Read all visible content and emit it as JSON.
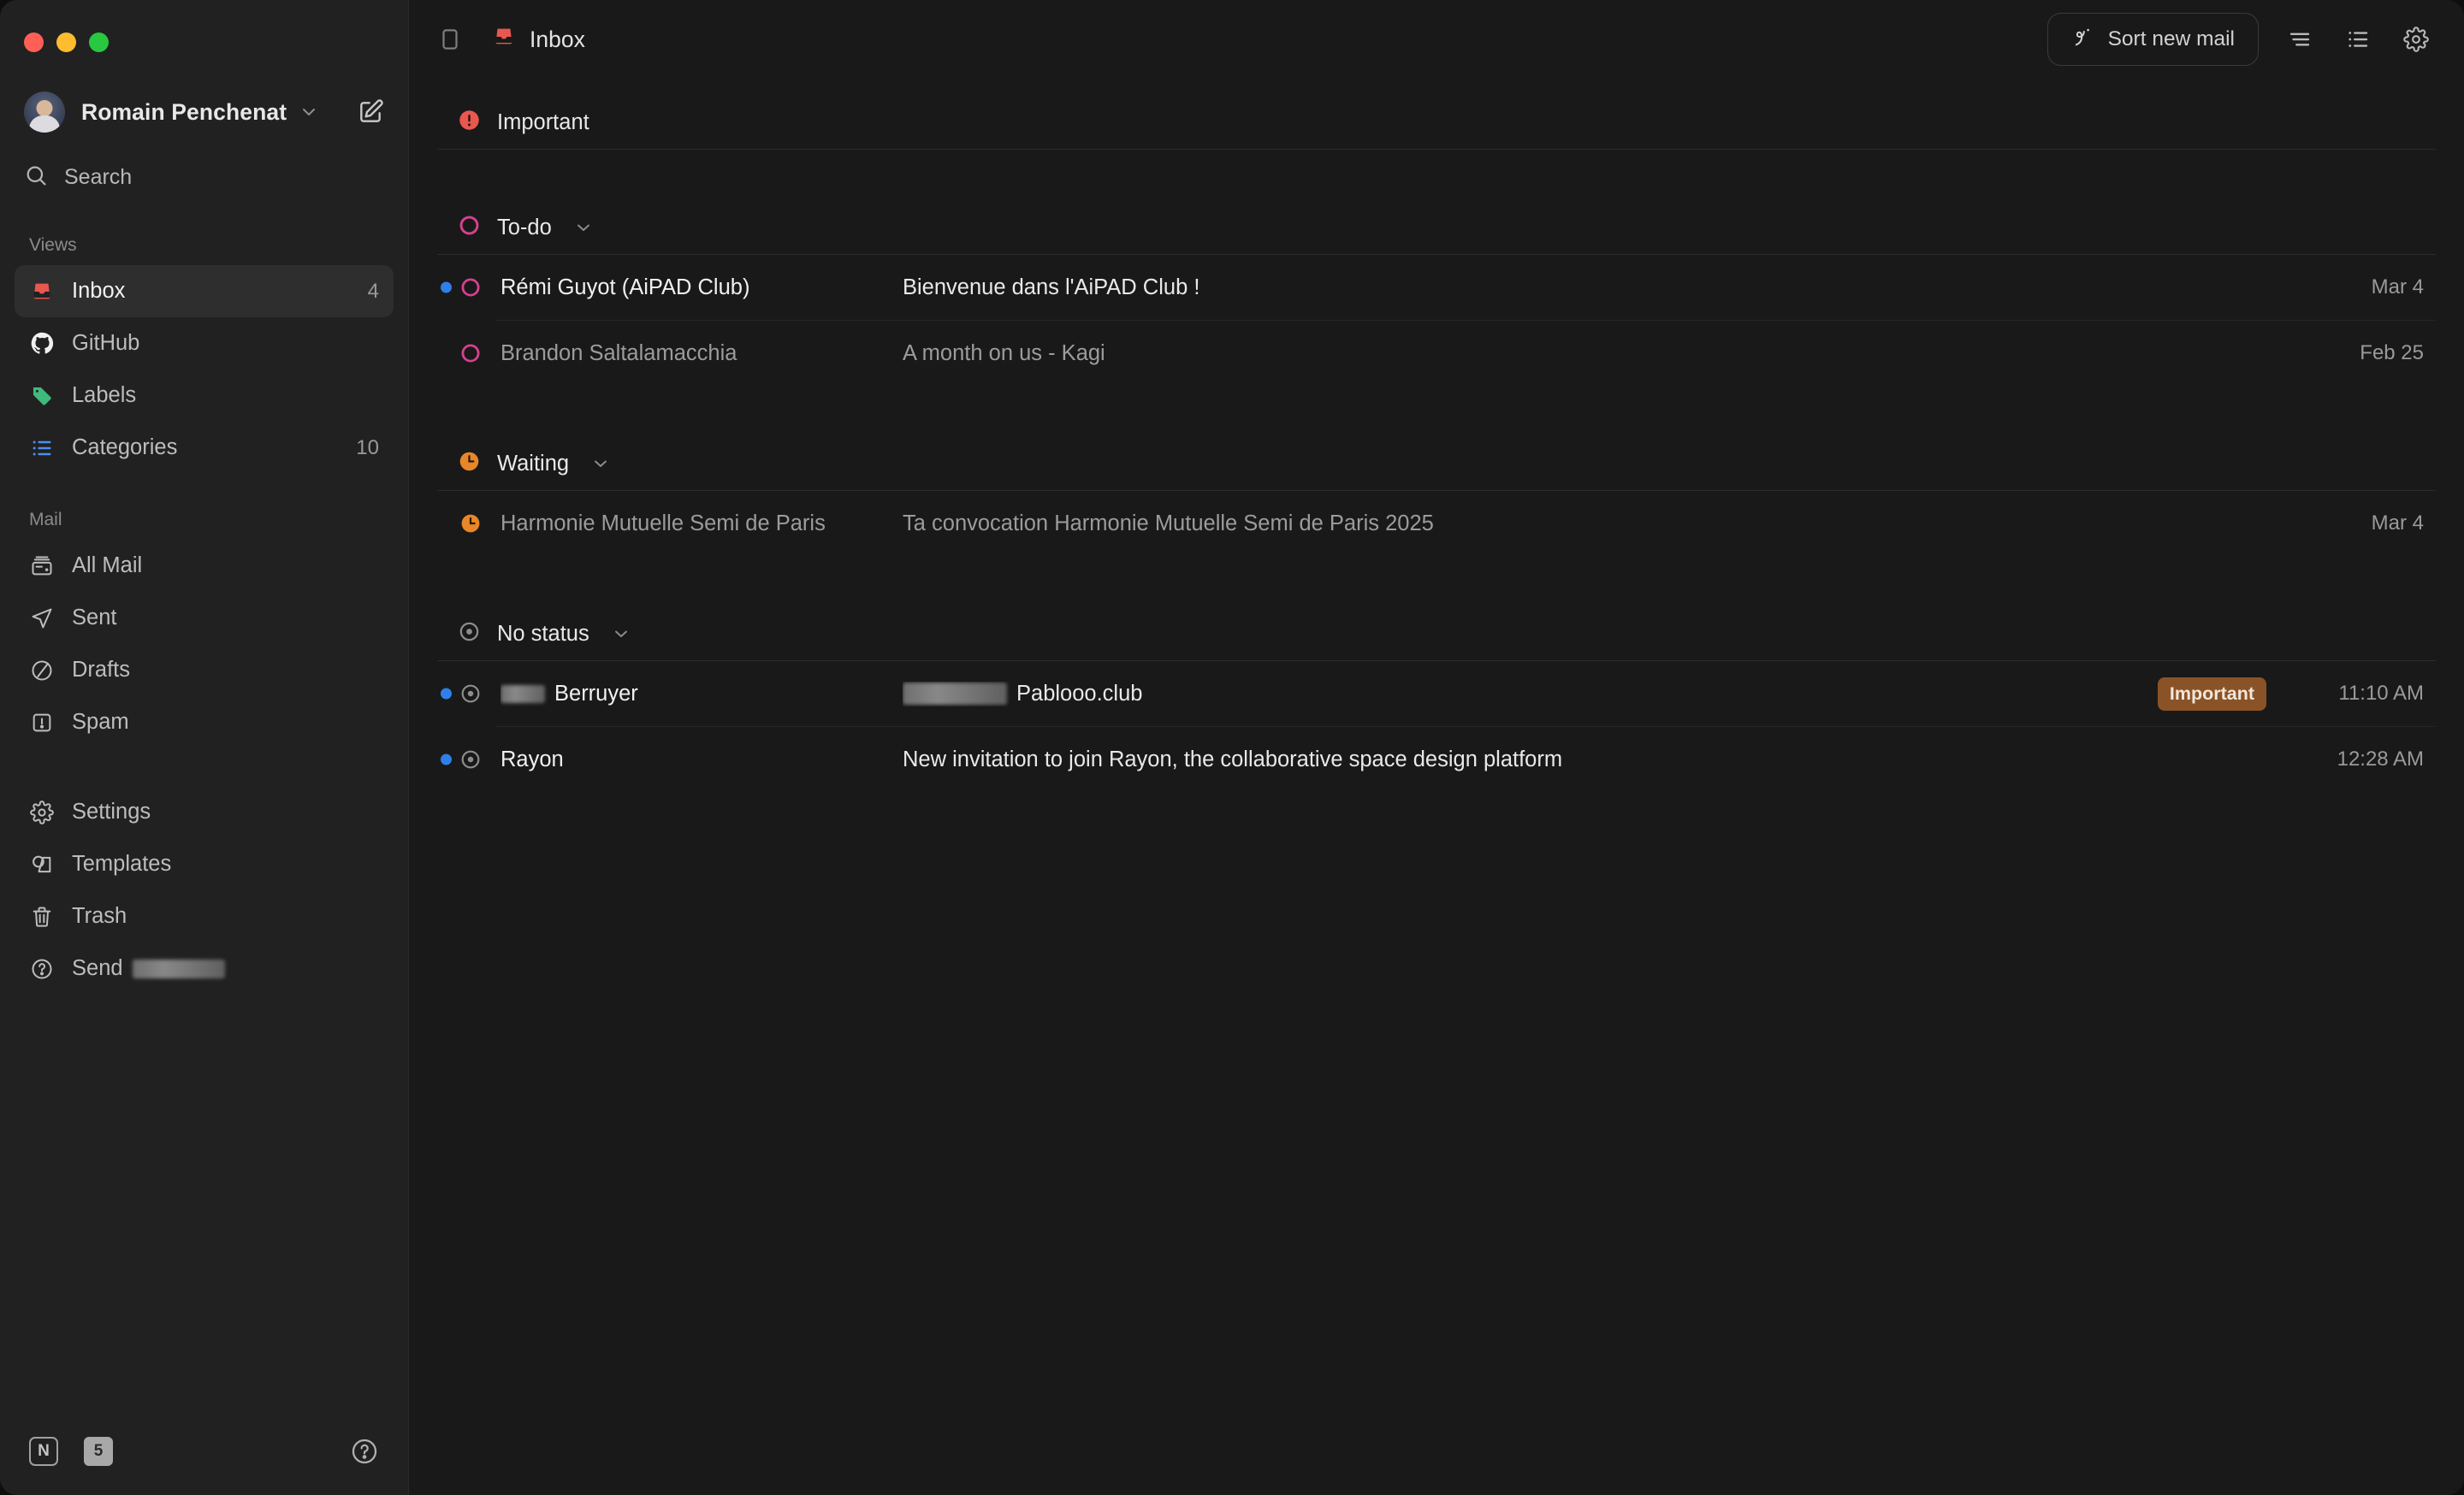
{
  "window": {
    "traffic_lights": [
      "close",
      "minimize",
      "zoom"
    ]
  },
  "sidebar": {
    "account": {
      "name": "Romain Penchenat"
    },
    "search": {
      "label": "Search"
    },
    "views_label": "Views",
    "views": [
      {
        "label": "Inbox",
        "icon": "inbox-icon",
        "badge": "4",
        "active": true
      },
      {
        "label": "GitHub",
        "icon": "github-icon",
        "badge": ""
      },
      {
        "label": "Labels",
        "icon": "tag-icon",
        "badge": ""
      },
      {
        "label": "Categories",
        "icon": "list-icon",
        "badge": "10"
      }
    ],
    "mail_label": "Mail",
    "mail": [
      {
        "label": "All Mail",
        "icon": "archive-icon"
      },
      {
        "label": "Sent",
        "icon": "paper-plane-icon"
      },
      {
        "label": "Drafts",
        "icon": "draft-circle-icon"
      },
      {
        "label": "Spam",
        "icon": "spam-icon"
      }
    ],
    "utility": [
      {
        "label": "Settings",
        "icon": "gear-icon"
      },
      {
        "label": "Templates",
        "icon": "templates-icon"
      },
      {
        "label": "Trash",
        "icon": "trash-icon"
      }
    ],
    "send_feedback": {
      "label": "Send",
      "icon": "question-circle-icon",
      "redacted": true
    },
    "footer": {
      "notion_badge": "N",
      "count_badge": "5",
      "help": "help-circle-icon"
    }
  },
  "topbar": {
    "panel_toggle": "sidebar-toggle-icon",
    "title": "Inbox",
    "title_icon": "inbox-icon",
    "sort_button": {
      "label": "Sort new mail",
      "icon": "magic-wand-icon"
    },
    "actions": [
      "filter-icon",
      "list-view-icon",
      "gear-icon"
    ]
  },
  "groups": [
    {
      "title": "Important",
      "icon": "important-circle-icon",
      "color": "#e9574f",
      "collapsible": false,
      "emails": []
    },
    {
      "title": "To-do",
      "icon": "todo-circle-icon",
      "color": "#d6418f",
      "collapsible": true,
      "emails": [
        {
          "sender": "Rémi Guyot (AiPAD Club)",
          "subject": "Bienvenue dans l'AiPAD Club !",
          "date": "Mar 4",
          "unread": true,
          "tag": "",
          "sender_redacted": false,
          "subject_redacted": false
        },
        {
          "sender": "Brandon Saltalamacchia",
          "subject": "A month on us - Kagi",
          "date": "Feb 25",
          "unread": false,
          "tag": "",
          "sender_redacted": false,
          "subject_redacted": false
        }
      ]
    },
    {
      "title": "Waiting",
      "icon": "clock-icon",
      "color": "#e8862a",
      "collapsible": true,
      "emails": [
        {
          "sender": "Harmonie Mutuelle Semi de Paris",
          "subject": "Ta convocation Harmonie Mutuelle Semi de Paris 2025",
          "date": "Mar 4",
          "unread": false,
          "tag": "",
          "sender_redacted": false,
          "subject_redacted": false
        }
      ]
    },
    {
      "title": "No status",
      "icon": "target-icon",
      "color": "#8d8d8d",
      "collapsible": true,
      "emails": [
        {
          "sender": "Berruyer",
          "subject": "Pablooo.club",
          "date": "11:10 AM",
          "unread": true,
          "tag": "Important",
          "sender_redacted": true,
          "subject_redacted": true
        },
        {
          "sender": "Rayon",
          "subject": "New invitation to join Rayon, the collaborative space design platform",
          "date": "12:28 AM",
          "unread": true,
          "tag": "",
          "sender_redacted": false,
          "subject_redacted": false
        }
      ]
    }
  ],
  "colors": {
    "sidebar_bg": "#212121",
    "main_bg": "#191919",
    "accent_unread": "#2f7fe8",
    "tag_important": "#8a5327",
    "inbox_red": "#e9574f",
    "todo_pink": "#d6418f",
    "waiting_orange": "#e8862a",
    "labels_green": "#3fba7d",
    "categories_blue": "#4a8ef0"
  }
}
